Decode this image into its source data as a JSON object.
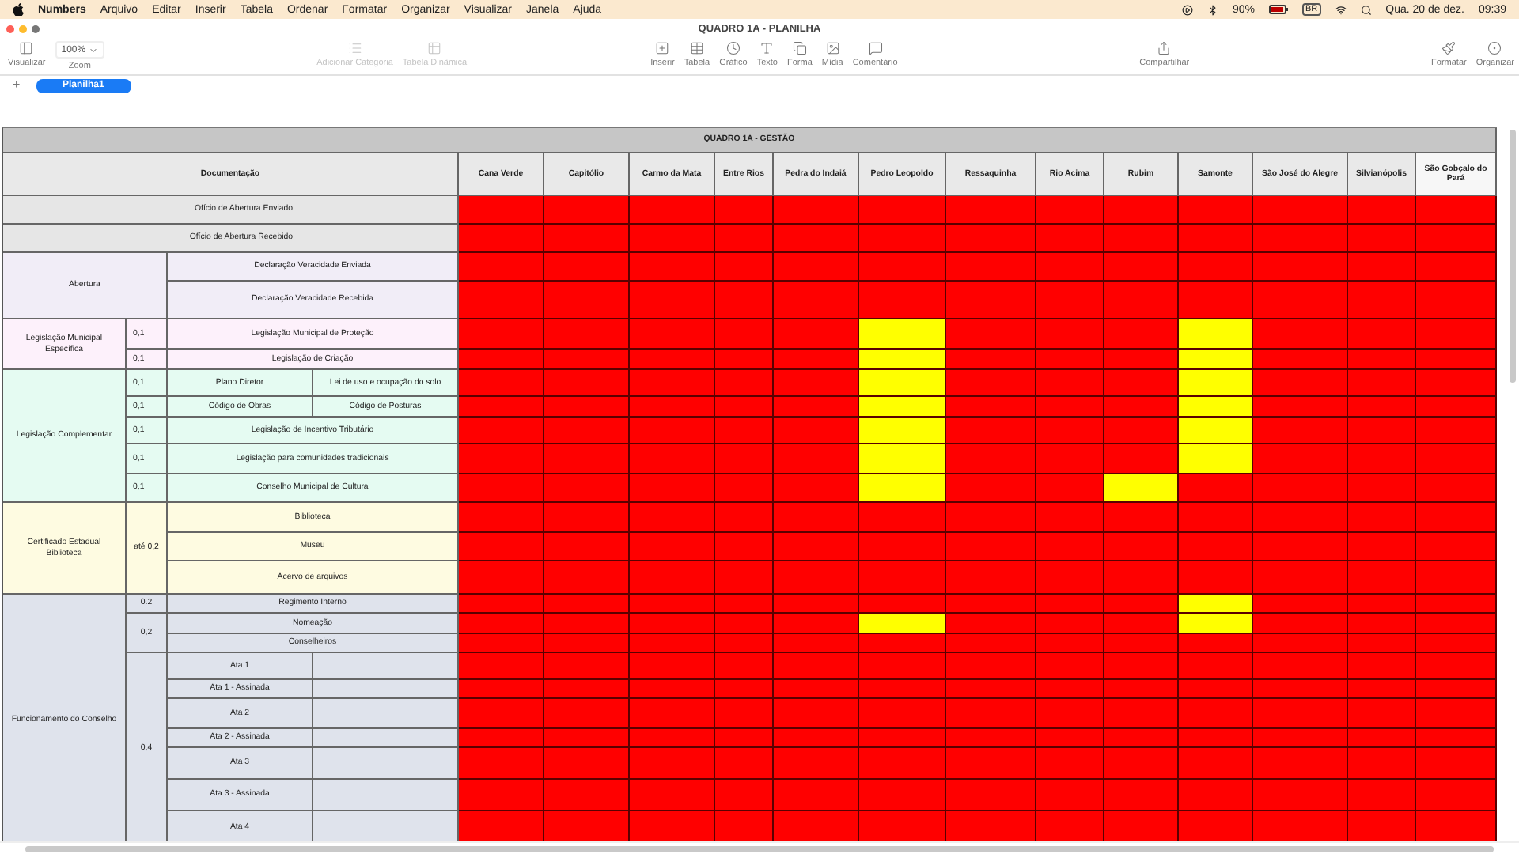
{
  "menu_bar": {
    "app": "Numbers",
    "menus": [
      "Arquivo",
      "Editar",
      "Inserir",
      "Tabela",
      "Ordenar",
      "Formatar",
      "Organizar",
      "Visualizar",
      "Janela",
      "Ajuda"
    ],
    "battery": "90%",
    "input_source": "BR",
    "date": "Qua. 20 de dez.",
    "time": "09:39"
  },
  "window": {
    "title": "QUADRO 1A - PLANILHA"
  },
  "toolbar": [
    {
      "kind": "button",
      "label": "Visualizar",
      "disabled": false
    },
    {
      "kind": "zoom",
      "label": "Zoom",
      "value": "100%",
      "disabled": false
    },
    {
      "kind": "button",
      "label": "Adicionar Categoria",
      "disabled": true
    },
    {
      "kind": "button",
      "label": "Tabela Dinâmica",
      "disabled": true
    },
    {
      "kind": "button",
      "label": "Inserir",
      "disabled": false
    },
    {
      "kind": "button",
      "label": "Tabela",
      "disabled": false
    },
    {
      "kind": "button",
      "label": "Gráfico",
      "disabled": false
    },
    {
      "kind": "button",
      "label": "Texto",
      "disabled": false
    },
    {
      "kind": "button",
      "label": "Forma",
      "disabled": false
    },
    {
      "kind": "button",
      "label": "Mídia",
      "disabled": false
    },
    {
      "kind": "button",
      "label": "Comentário",
      "disabled": false
    },
    {
      "kind": "button",
      "label": "Compartilhar",
      "disabled": false
    },
    {
      "kind": "button",
      "label": "Formatar",
      "disabled": false
    },
    {
      "kind": "button",
      "label": "Organizar",
      "disabled": false
    }
  ],
  "sheet_tabs": {
    "add": "+",
    "tabs": [
      {
        "label": "Planilha1",
        "selected": true
      }
    ]
  },
  "table": {
    "title": "QUADRO 1A - GESTÃO",
    "doc_header": "Documentação",
    "cities": [
      "Cana Verde",
      "Capitólio",
      "Carmo da Mata",
      "Entre Rios",
      "Pedra do Indaiá",
      "Pedro Leopoldo",
      "Ressaquinha",
      "Rio Acima",
      "Rubim",
      "Samonte",
      "São José do Alegre",
      "Silvianópolis",
      "São Gobçalo do Pará"
    ],
    "doc_cells": [
      {
        "text": "Ofício de Abertura Enviado",
        "color": "#e6e6e6"
      },
      {
        "text": "Ofício de Abertura Recebido",
        "color": "#e6e6e6"
      },
      {
        "text": "Abertura",
        "color": "#f1edf7"
      },
      {
        "text": "Declaração Veracidade Enviada",
        "color": "#f1edf7"
      },
      {
        "text": "Declaração Veracidade Recebida",
        "color": "#f1edf7"
      },
      {
        "text": "Legislação Municipal Específica",
        "color": "#fdf1fb"
      },
      {
        "text": "0,1",
        "color": "#fdf1fb"
      },
      {
        "text": "Legislação Municipal de Proteção",
        "color": "#fdf1fb"
      },
      {
        "text": "0,1",
        "color": "#fdf1fb"
      },
      {
        "text": "Legislação de Criação",
        "color": "#fdf1fb"
      },
      {
        "text": "Legislação Complementar",
        "color": "#e5fbf2"
      },
      {
        "text": "0,1",
        "color": "#e5fbf2"
      },
      {
        "text": "Plano Diretor",
        "color": "#e5fbf2"
      },
      {
        "text": "Lei de uso e ocupação do solo",
        "color": "#e5fbf2"
      },
      {
        "text": "0,1",
        "color": "#e5fbf2"
      },
      {
        "text": "Código de Obras",
        "color": "#e5fbf2"
      },
      {
        "text": "Código de Posturas",
        "color": "#e5fbf2"
      },
      {
        "text": "0,1",
        "color": "#e5fbf2"
      },
      {
        "text": "Legislação de Incentivo Tributário",
        "color": "#e5fbf2"
      },
      {
        "text": "0,1",
        "color": "#e5fbf2"
      },
      {
        "text": "Legislação para comunidades tradicionais",
        "color": "#e5fbf2"
      },
      {
        "text": "0,1",
        "color": "#e5fbf2"
      },
      {
        "text": "Conselho Municipal de Cultura",
        "color": "#e5fbf2"
      },
      {
        "text": "Certificado Estadual Biblioteca",
        "color": "#fefbe1"
      },
      {
        "text": "até 0,2",
        "color": "#fefbe1"
      },
      {
        "text": "Biblioteca",
        "color": "#fefbe1"
      },
      {
        "text": "Museu",
        "color": "#fefbe1"
      },
      {
        "text": "Acervo de arquivos",
        "color": "#fefbe1"
      },
      {
        "text": "Funcionamento do Conselho",
        "color": "#dfe3ec"
      },
      {
        "text": "0.2",
        "color": "#dfe3ec"
      },
      {
        "text": "Regimento Interno",
        "color": "#dfe3ec"
      },
      {
        "text": "0,2",
        "color": "#dfe3ec"
      },
      {
        "text": "Nomeação",
        "color": "#dfe3ec"
      },
      {
        "text": "Conselheiros",
        "color": "#dfe3ec"
      },
      {
        "text": "0,4",
        "color": "#dfe3ec"
      },
      {
        "text": "Ata 1",
        "color": "#dfe3ec"
      },
      {
        "text": "Ata 1 - Assinada",
        "color": "#dfe3ec"
      },
      {
        "text": "Ata 2",
        "color": "#dfe3ec"
      },
      {
        "text": "Ata 2 - Assinada",
        "color": "#dfe3ec"
      },
      {
        "text": "Ata 3",
        "color": "#dfe3ec"
      },
      {
        "text": "Ata 3 - Assinada",
        "color": "#dfe3ec"
      },
      {
        "text": "Ata 4",
        "color": "#dfe3ec"
      }
    ],
    "rows": [
      {
        "cells": [
          {
            "color": "#ff0000"
          },
          {
            "color": "#ff0000"
          },
          {
            "color": "#ff0000"
          },
          {
            "color": "#ff0000"
          },
          {
            "color": "#ff0000"
          },
          {
            "color": "#ff0000"
          },
          {
            "color": "#ff0000"
          },
          {
            "color": "#ff0000"
          },
          {
            "color": "#ff0000"
          },
          {
            "color": "#ff0000"
          },
          {
            "color": "#ff0000"
          },
          {
            "color": "#ff0000"
          },
          {
            "color": "#ff0000"
          }
        ]
      },
      {
        "cells": [
          {
            "color": "#ff0000"
          },
          {
            "color": "#ff0000"
          },
          {
            "color": "#ff0000"
          },
          {
            "color": "#ff0000"
          },
          {
            "color": "#ff0000"
          },
          {
            "color": "#ff0000"
          },
          {
            "color": "#ff0000"
          },
          {
            "color": "#ff0000"
          },
          {
            "color": "#ff0000"
          },
          {
            "color": "#ff0000"
          },
          {
            "color": "#ff0000"
          },
          {
            "color": "#ff0000"
          },
          {
            "color": "#ff0000"
          }
        ]
      },
      {
        "cells": [
          {
            "color": "#ff0000"
          },
          {
            "color": "#ff0000"
          },
          {
            "color": "#ff0000"
          },
          {
            "color": "#ff0000"
          },
          {
            "color": "#ff0000"
          },
          {
            "color": "#ff0000"
          },
          {
            "color": "#ff0000"
          },
          {
            "color": "#ff0000"
          },
          {
            "color": "#ff0000"
          },
          {
            "color": "#ff0000"
          },
          {
            "color": "#ff0000"
          },
          {
            "color": "#ff0000"
          },
          {
            "color": "#ff0000"
          }
        ]
      },
      {
        "cells": [
          {
            "color": "#ff0000"
          },
          {
            "color": "#ff0000"
          },
          {
            "color": "#ff0000"
          },
          {
            "color": "#ff0000"
          },
          {
            "color": "#ff0000"
          },
          {
            "color": "#ff0000"
          },
          {
            "color": "#ff0000"
          },
          {
            "color": "#ff0000"
          },
          {
            "color": "#ff0000"
          },
          {
            "color": "#ff0000"
          },
          {
            "color": "#ff0000"
          },
          {
            "color": "#ff0000"
          },
          {
            "color": "#ff0000"
          }
        ]
      },
      {
        "cells": [
          {
            "color": "#ff0000"
          },
          {
            "color": "#ff0000"
          },
          {
            "color": "#ff0000"
          },
          {
            "color": "#ff0000"
          },
          {
            "color": "#ff0000"
          },
          {
            "color": "#ffff00"
          },
          {
            "color": "#ff0000"
          },
          {
            "color": "#ff0000"
          },
          {
            "color": "#ff0000"
          },
          {
            "color": "#ffff00"
          },
          {
            "color": "#ff0000"
          },
          {
            "color": "#ff0000"
          },
          {
            "color": "#ff0000"
          }
        ]
      },
      {
        "cells": [
          {
            "color": "#ff0000"
          },
          {
            "color": "#ff0000"
          },
          {
            "color": "#ff0000"
          },
          {
            "color": "#ff0000"
          },
          {
            "color": "#ff0000"
          },
          {
            "color": "#ffff00"
          },
          {
            "color": "#ff0000"
          },
          {
            "color": "#ff0000"
          },
          {
            "color": "#ff0000"
          },
          {
            "color": "#ffff00"
          },
          {
            "color": "#ff0000"
          },
          {
            "color": "#ff0000"
          },
          {
            "color": "#ff0000"
          }
        ]
      },
      {
        "cells": [
          {
            "color": "#ff0000"
          },
          {
            "color": "#ff0000"
          },
          {
            "color": "#ff0000"
          },
          {
            "color": "#ff0000"
          },
          {
            "color": "#ff0000"
          },
          {
            "color": "#ffff00"
          },
          {
            "color": "#ff0000"
          },
          {
            "color": "#ff0000"
          },
          {
            "color": "#ff0000"
          },
          {
            "color": "#ffff00"
          },
          {
            "color": "#ff0000"
          },
          {
            "color": "#ff0000"
          },
          {
            "color": "#ff0000"
          }
        ]
      },
      {
        "cells": [
          {
            "color": "#ff0000"
          },
          {
            "color": "#ff0000"
          },
          {
            "color": "#ff0000"
          },
          {
            "color": "#ff0000"
          },
          {
            "color": "#ff0000"
          },
          {
            "color": "#ffff00"
          },
          {
            "color": "#ff0000"
          },
          {
            "color": "#ff0000"
          },
          {
            "color": "#ff0000"
          },
          {
            "color": "#ffff00"
          },
          {
            "color": "#ff0000"
          },
          {
            "color": "#ff0000"
          },
          {
            "color": "#ff0000"
          }
        ]
      },
      {
        "cells": [
          {
            "color": "#ff0000"
          },
          {
            "color": "#ff0000"
          },
          {
            "color": "#ff0000"
          },
          {
            "color": "#ff0000"
          },
          {
            "color": "#ff0000"
          },
          {
            "color": "#ffff00"
          },
          {
            "color": "#ff0000"
          },
          {
            "color": "#ff0000"
          },
          {
            "color": "#ff0000"
          },
          {
            "color": "#ffff00"
          },
          {
            "color": "#ff0000"
          },
          {
            "color": "#ff0000"
          },
          {
            "color": "#ff0000"
          }
        ]
      },
      {
        "cells": [
          {
            "color": "#ff0000"
          },
          {
            "color": "#ff0000"
          },
          {
            "color": "#ff0000"
          },
          {
            "color": "#ff0000"
          },
          {
            "color": "#ff0000"
          },
          {
            "color": "#ffff00"
          },
          {
            "color": "#ff0000"
          },
          {
            "color": "#ff0000"
          },
          {
            "color": "#ff0000"
          },
          {
            "color": "#ffff00"
          },
          {
            "color": "#ff0000"
          },
          {
            "color": "#ff0000"
          },
          {
            "color": "#ff0000"
          }
        ]
      },
      {
        "cells": [
          {
            "color": "#ff0000"
          },
          {
            "color": "#ff0000"
          },
          {
            "color": "#ff0000"
          },
          {
            "color": "#ff0000"
          },
          {
            "color": "#ff0000"
          },
          {
            "color": "#ffff00"
          },
          {
            "color": "#ff0000"
          },
          {
            "color": "#ff0000"
          },
          {
            "color": "#ffff00"
          },
          {
            "color": "#ff0000"
          },
          {
            "color": "#ff0000"
          },
          {
            "color": "#ff0000"
          },
          {
            "color": "#ff0000"
          }
        ]
      },
      {
        "cells": [
          {
            "color": "#ff0000"
          },
          {
            "color": "#ff0000"
          },
          {
            "color": "#ff0000"
          },
          {
            "color": "#ff0000"
          },
          {
            "color": "#ff0000"
          },
          {
            "color": "#ff0000"
          },
          {
            "color": "#ff0000"
          },
          {
            "color": "#ff0000"
          },
          {
            "color": "#ff0000"
          },
          {
            "color": "#ff0000"
          },
          {
            "color": "#ff0000"
          },
          {
            "color": "#ff0000"
          },
          {
            "color": "#ff0000"
          }
        ]
      },
      {
        "cells": [
          {
            "color": "#ff0000"
          },
          {
            "color": "#ff0000"
          },
          {
            "color": "#ff0000"
          },
          {
            "color": "#ff0000"
          },
          {
            "color": "#ff0000"
          },
          {
            "color": "#ff0000"
          },
          {
            "color": "#ff0000"
          },
          {
            "color": "#ff0000"
          },
          {
            "color": "#ff0000"
          },
          {
            "color": "#ff0000"
          },
          {
            "color": "#ff0000"
          },
          {
            "color": "#ff0000"
          },
          {
            "color": "#ff0000"
          }
        ]
      },
      {
        "cells": [
          {
            "color": "#ff0000"
          },
          {
            "color": "#ff0000"
          },
          {
            "color": "#ff0000"
          },
          {
            "color": "#ff0000"
          },
          {
            "color": "#ff0000"
          },
          {
            "color": "#ff0000"
          },
          {
            "color": "#ff0000"
          },
          {
            "color": "#ff0000"
          },
          {
            "color": "#ff0000"
          },
          {
            "color": "#ff0000"
          },
          {
            "color": "#ff0000"
          },
          {
            "color": "#ff0000"
          },
          {
            "color": "#ff0000"
          }
        ]
      },
      {
        "cells": [
          {
            "color": "#ff0000"
          },
          {
            "color": "#ff0000"
          },
          {
            "color": "#ff0000"
          },
          {
            "color": "#ff0000"
          },
          {
            "color": "#ff0000"
          },
          {
            "color": "#ff0000"
          },
          {
            "color": "#ff0000"
          },
          {
            "color": "#ff0000"
          },
          {
            "color": "#ff0000"
          },
          {
            "color": "#ffff00"
          },
          {
            "color": "#ff0000"
          },
          {
            "color": "#ff0000"
          },
          {
            "color": "#ff0000"
          }
        ]
      },
      {
        "cells": [
          {
            "color": "#ff0000"
          },
          {
            "color": "#ff0000"
          },
          {
            "color": "#ff0000"
          },
          {
            "color": "#ff0000"
          },
          {
            "color": "#ff0000"
          },
          {
            "color": "#ffff00"
          },
          {
            "color": "#ff0000"
          },
          {
            "color": "#ff0000"
          },
          {
            "color": "#ff0000"
          },
          {
            "color": "#ffff00"
          },
          {
            "color": "#ff0000"
          },
          {
            "color": "#ff0000"
          },
          {
            "color": "#ff0000"
          }
        ]
      },
      {
        "cells": [
          {
            "color": "#ff0000"
          },
          {
            "color": "#ff0000"
          },
          {
            "color": "#ff0000"
          },
          {
            "color": "#ff0000"
          },
          {
            "color": "#ff0000"
          },
          {
            "color": "#ff0000"
          },
          {
            "color": "#ff0000"
          },
          {
            "color": "#ff0000"
          },
          {
            "color": "#ff0000"
          },
          {
            "color": "#ff0000"
          },
          {
            "color": "#ff0000"
          },
          {
            "color": "#ff0000"
          },
          {
            "color": "#ff0000"
          }
        ]
      },
      {
        "cells": [
          {
            "color": "#ff0000"
          },
          {
            "color": "#ff0000"
          },
          {
            "color": "#ff0000"
          },
          {
            "color": "#ff0000"
          },
          {
            "color": "#ff0000"
          },
          {
            "color": "#ff0000"
          },
          {
            "color": "#ff0000"
          },
          {
            "color": "#ff0000"
          },
          {
            "color": "#ff0000"
          },
          {
            "color": "#ff0000"
          },
          {
            "color": "#ff0000"
          },
          {
            "color": "#ff0000"
          },
          {
            "color": "#ff0000"
          }
        ]
      },
      {
        "cells": [
          {
            "color": "#ff0000"
          },
          {
            "color": "#ff0000"
          },
          {
            "color": "#ff0000"
          },
          {
            "color": "#ff0000"
          },
          {
            "color": "#ff0000"
          },
          {
            "color": "#ff0000"
          },
          {
            "color": "#ff0000"
          },
          {
            "color": "#ff0000"
          },
          {
            "color": "#ff0000"
          },
          {
            "color": "#ff0000"
          },
          {
            "color": "#ff0000"
          },
          {
            "color": "#ff0000"
          },
          {
            "color": "#ff0000"
          }
        ]
      },
      {
        "cells": [
          {
            "color": "#ff0000"
          },
          {
            "color": "#ff0000"
          },
          {
            "color": "#ff0000"
          },
          {
            "color": "#ff0000"
          },
          {
            "color": "#ff0000"
          },
          {
            "color": "#ff0000"
          },
          {
            "color": "#ff0000"
          },
          {
            "color": "#ff0000"
          },
          {
            "color": "#ff0000"
          },
          {
            "color": "#ff0000"
          },
          {
            "color": "#ff0000"
          },
          {
            "color": "#ff0000"
          },
          {
            "color": "#ff0000"
          }
        ]
      },
      {
        "cells": [
          {
            "color": "#ff0000"
          },
          {
            "color": "#ff0000"
          },
          {
            "color": "#ff0000"
          },
          {
            "color": "#ff0000"
          },
          {
            "color": "#ff0000"
          },
          {
            "color": "#ff0000"
          },
          {
            "color": "#ff0000"
          },
          {
            "color": "#ff0000"
          },
          {
            "color": "#ff0000"
          },
          {
            "color": "#ff0000"
          },
          {
            "color": "#ff0000"
          },
          {
            "color": "#ff0000"
          },
          {
            "color": "#ff0000"
          }
        ]
      },
      {
        "cells": [
          {
            "color": "#ff0000"
          },
          {
            "color": "#ff0000"
          },
          {
            "color": "#ff0000"
          },
          {
            "color": "#ff0000"
          },
          {
            "color": "#ff0000"
          },
          {
            "color": "#ff0000"
          },
          {
            "color": "#ff0000"
          },
          {
            "color": "#ff0000"
          },
          {
            "color": "#ff0000"
          },
          {
            "color": "#ff0000"
          },
          {
            "color": "#ff0000"
          },
          {
            "color": "#ff0000"
          },
          {
            "color": "#ff0000"
          }
        ]
      },
      {
        "cells": [
          {
            "color": "#ff0000"
          },
          {
            "color": "#ff0000"
          },
          {
            "color": "#ff0000"
          },
          {
            "color": "#ff0000"
          },
          {
            "color": "#ff0000"
          },
          {
            "color": "#ff0000"
          },
          {
            "color": "#ff0000"
          },
          {
            "color": "#ff0000"
          },
          {
            "color": "#ff0000"
          },
          {
            "color": "#ff0000"
          },
          {
            "color": "#ff0000"
          },
          {
            "color": "#ff0000"
          },
          {
            "color": "#ff0000"
          }
        ]
      },
      {
        "cells": [
          {
            "color": "#ff0000"
          },
          {
            "color": "#ff0000"
          },
          {
            "color": "#ff0000"
          },
          {
            "color": "#ff0000"
          },
          {
            "color": "#ff0000"
          },
          {
            "color": "#ff0000"
          },
          {
            "color": "#ff0000"
          },
          {
            "color": "#ff0000"
          },
          {
            "color": "#ff0000"
          },
          {
            "color": "#ff0000"
          },
          {
            "color": "#ff0000"
          },
          {
            "color": "#ff0000"
          },
          {
            "color": "#ff0000"
          }
        ]
      }
    ]
  }
}
